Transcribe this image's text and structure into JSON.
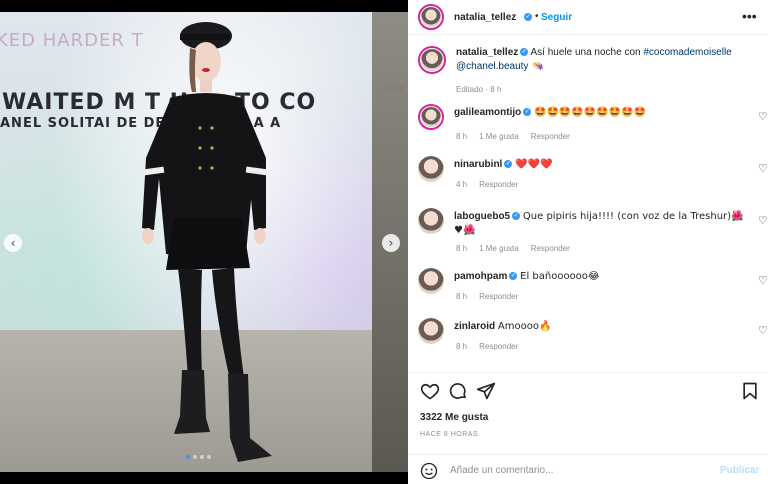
{
  "header": {
    "username": "natalia_tellez",
    "follow_label": "Seguir",
    "separator": "•",
    "more_label": "•••"
  },
  "media": {
    "text_lines": [
      "KED HARDER T",
      "WAITED M          T HAD TO CO",
      "ANEL SOLITAI        DE DELAY - GALLA A",
      "ROW"
    ],
    "prev_label": "‹",
    "next_label": "›",
    "slides": 4,
    "active_slide": 1
  },
  "caption": {
    "username": "natalia_tellez",
    "text_before": " Así huele una noche con ",
    "hashtag": "#cocomademoiselle",
    "mention": "@chanel.beauty",
    "emoji": " 👒",
    "meta_edited": "Editado",
    "meta_sep": " · ",
    "meta_time": "8 h"
  },
  "comments": [
    {
      "username": "galileamontijo",
      "text": "🤩🤩🤩🤩🤩🤩🤩🤩🤩",
      "time": "8 h",
      "likes": "1 Me gusta",
      "reply": "Responder"
    },
    {
      "username": "ninarubinl",
      "text": "❤️❤️❤️",
      "time": "4 h",
      "likes": "",
      "reply": "Responder"
    },
    {
      "username": "laboguebo5",
      "text": "Que pipiris hija!!!! (con voz de la Treshur)🌺♥🌺",
      "time": "8 h",
      "likes": "1 Me gusta",
      "reply": "Responder"
    },
    {
      "username": "pamohpam",
      "text": "El bañoooooo😂",
      "time": "8 h",
      "likes": "",
      "reply": "Responder"
    },
    {
      "username": "zinlaroid",
      "text": "Amoooo🔥",
      "time": "8 h",
      "likes": "",
      "reply": "Responder"
    }
  ],
  "stats": {
    "likes": "3322 Me gusta",
    "time": "HACE 8 HORAS"
  },
  "add_comment": {
    "placeholder": "Añade un comentario...",
    "publish_label": "Publicar"
  },
  "colors": {
    "accent": "#0095f6",
    "verified": "#3897f0",
    "muted": "#8e8e8e",
    "link": "#00376b",
    "publish_disabled": "#b2dffc"
  }
}
